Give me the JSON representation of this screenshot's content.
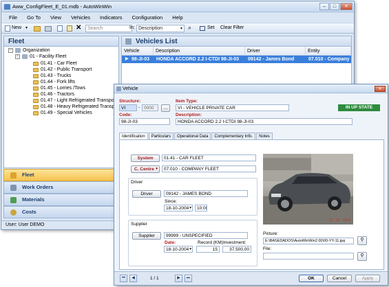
{
  "main_window": {
    "title": "Aww_ConfigFleet_E_01.mdb - AutoWinWin",
    "menu": [
      "File",
      "Go To",
      "View",
      "Vehicles",
      "Indicators",
      "Configuration",
      "Help"
    ],
    "toolbar": {
      "new_label": "New",
      "search_placeholder": "Search",
      "in_label": "In:",
      "in_value": "Description",
      "set_label": "Set",
      "clear_filter_label": "Clear Filter"
    },
    "left_panel": {
      "title": "Fleet",
      "tree": {
        "root": "Organization",
        "group": "01 - Facility Fleet",
        "items": [
          "01.41 - Car Fleet",
          "01.42 - Public Transport",
          "01.43 - Trucks",
          "01.44 - Fork lifts",
          "01.45 - Lorries /Tows",
          "01.46 - Tractors",
          "01.47 - Light Refrigerated Transport",
          "01.48 - Heavy Refrigerated Transport",
          "01.49 - Special Vehicles"
        ]
      },
      "nav": [
        "Fleet",
        "Work Orders",
        "Materials",
        "Costs"
      ]
    },
    "right_panel": {
      "title": "Vehicles List",
      "columns": [
        "Vehicle",
        "Description",
        "Driver",
        "Entity"
      ],
      "rows": [
        {
          "vehicle": "98-JI-03",
          "description": "HONDA ACCORD 2.2 I-CTDI 98-JI-03",
          "driver": "09142 - James Bond",
          "entity": "07.010 - Company ..."
        }
      ]
    },
    "status": "User: User DEMO"
  },
  "dialog": {
    "title": "Vehicle",
    "structure_label": "Structure:",
    "structure_value_1": "VI",
    "structure_value_2": "0000",
    "item_type_label": "Item Type:",
    "item_type_value": "VI - VEHICLE PRIVATE CAR",
    "state_badge": "IN UP STATE",
    "code_label": "Code:",
    "code_value": "98-JI-03",
    "description_label": "Description:",
    "description_value": "HONDA ACCORD 2.2 I-CTDI 98-JI-03",
    "tabs": [
      "Identification",
      "Particulars",
      "Operational Data",
      "Complementary Info.",
      "Notes"
    ],
    "system_button": "System",
    "system_value": "01.41 - CAR FLEET",
    "centre_button": "C. Centre",
    "centre_value": "07.010 - COMPANY FLEET",
    "driver_group": "Driver",
    "driver_button": "Driver",
    "driver_value": "09142 - JAMES BOND",
    "since_label": "Since:",
    "since_date": "18-10-2004",
    "since_time": "10:00",
    "supplier_group": "Supplier",
    "supplier_button": "Supplier",
    "supplier_value": "99999 - UNSPECIFIED",
    "date_label": "Date:",
    "date_value": "18-10-2004",
    "record_km_label": "Record (KM):",
    "record_km_value": "15",
    "investment_label": "Investment:",
    "investment_value": "37.500,00",
    "picture_label": "Picture:",
    "picture_value": "E:\\BASEDADOS\\AutoWinWin2.00\\00-YY-11.jpg",
    "file_label": "File:",
    "photo_stamp": "13 - 10 - 2004",
    "pager": "1 / 1",
    "ok_label": "OK",
    "cancel_label": "Cancel",
    "apply_label": "Apply"
  },
  "colors": {
    "accent": "#3a7fdc",
    "nav_selected": "#f6c34e",
    "state_badge": "#2e8b3e",
    "required_label": "#b01818"
  }
}
